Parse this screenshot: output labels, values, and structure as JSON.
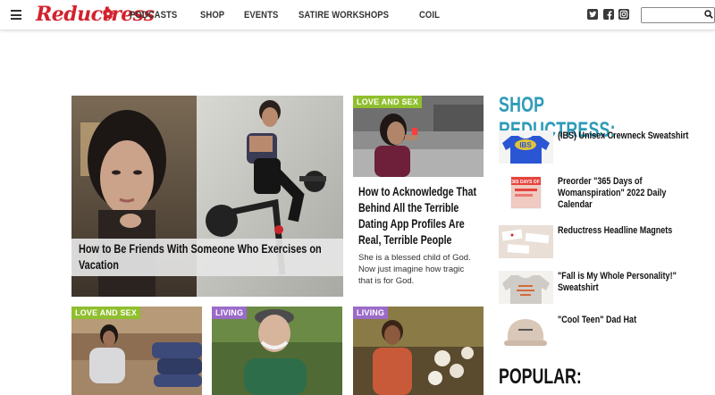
{
  "brand": {
    "name": "Reductress",
    "accent_color": "#d2222d"
  },
  "nav": {
    "menu_icon": "hamburger-menu-icon",
    "items": [
      {
        "label": "PODCASTS"
      },
      {
        "label": "SHOP"
      },
      {
        "label": "EVENTS"
      },
      {
        "label": "SATIRE WORKSHOPS"
      },
      {
        "label": "COIL"
      }
    ],
    "social_icons": [
      "twitter-icon",
      "facebook-icon",
      "instagram-icon"
    ],
    "search": {
      "placeholder": "",
      "icon": "search-icon"
    }
  },
  "featured": {
    "hero": {
      "title": "How to Be Friends With Someone Who Exercises on Vacation"
    },
    "story": {
      "tag": "LOVE AND SEX",
      "title": "How to Acknowledge That Behind All the Terrible Dating App Profiles Are Real, Terrible People",
      "dek": "She is a blessed child of God. Now just imagine how tragic that is for God."
    },
    "grid": [
      {
        "tag": "LOVE AND SEX",
        "tag_color": "#8fbf2e"
      },
      {
        "tag": "LIVING",
        "tag_color": "#9b6bc9"
      },
      {
        "tag": "LIVING",
        "tag_color": "#9b6bc9"
      }
    ]
  },
  "shop": {
    "heading": "SHOP REDUCTRESS:",
    "heading_color": "#2d9bb8",
    "items": [
      {
        "label": "(IBS) Unisex Crewneck Sweatshirt",
        "thumb_text": "IBS"
      },
      {
        "label": "Preorder \"365 Days of Womanspiration\" 2022 Daily Calendar",
        "thumb_text": "365 DAYS OF"
      },
      {
        "label": "Reductress Headline Magnets"
      },
      {
        "label": "\"Fall is My Whole Personality!\" Sweatshirt"
      },
      {
        "label": "\"Cool Teen\" Dad Hat"
      }
    ]
  },
  "popular": {
    "heading": "POPULAR:"
  }
}
